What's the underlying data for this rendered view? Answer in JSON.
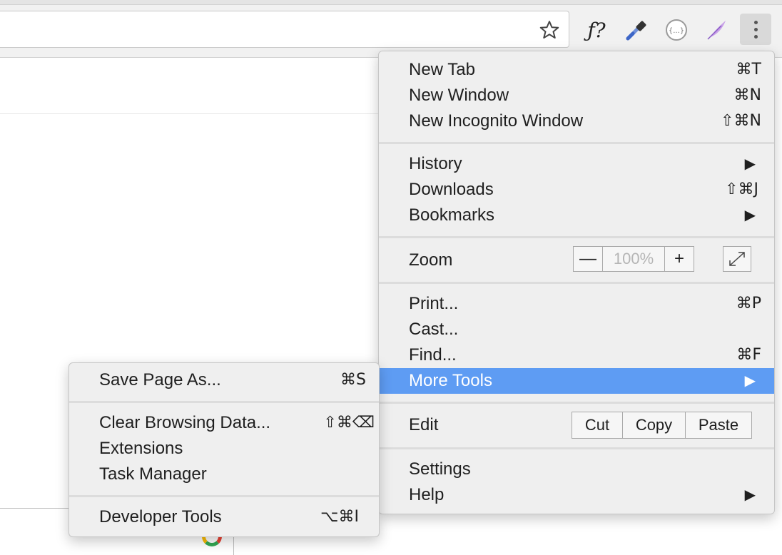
{
  "toolbar": {
    "ext_fn_label": "ƒ?",
    "icons": [
      "star-icon",
      "eyedropper-icon",
      "json-icon",
      "quill-icon",
      "kebab-menu-icon"
    ]
  },
  "main_menu": {
    "new_tab": {
      "label": "New Tab",
      "shortcut": "⌘T"
    },
    "new_window": {
      "label": "New Window",
      "shortcut": "⌘N"
    },
    "new_incognito": {
      "label": "New Incognito Window",
      "shortcut": "⇧⌘N"
    },
    "history": {
      "label": "History",
      "arrow": "▶"
    },
    "downloads": {
      "label": "Downloads",
      "shortcut": "⇧⌘J"
    },
    "bookmarks": {
      "label": "Bookmarks",
      "arrow": "▶"
    },
    "zoom": {
      "label": "Zoom",
      "minus": "—",
      "level": "100%",
      "plus": "+"
    },
    "print": {
      "label": "Print...",
      "shortcut": "⌘P"
    },
    "cast": {
      "label": "Cast..."
    },
    "find": {
      "label": "Find...",
      "shortcut": "⌘F"
    },
    "more_tools": {
      "label": "More Tools",
      "arrow": "▶"
    },
    "edit": {
      "label": "Edit",
      "cut": "Cut",
      "copy": "Copy",
      "paste": "Paste"
    },
    "settings": {
      "label": "Settings"
    },
    "help": {
      "label": "Help",
      "arrow": "▶"
    }
  },
  "sub_menu": {
    "save_page": {
      "label": "Save Page As...",
      "shortcut": "⌘S"
    },
    "clear_data": {
      "label": "Clear Browsing Data...",
      "shortcut": "⇧⌘⌫"
    },
    "extensions": {
      "label": "Extensions"
    },
    "task_manager": {
      "label": "Task Manager"
    },
    "dev_tools": {
      "label": "Developer Tools",
      "shortcut": "⌥⌘I"
    }
  },
  "colors": {
    "highlight": "#5e9cf3",
    "menu_bg": "#efefef"
  }
}
